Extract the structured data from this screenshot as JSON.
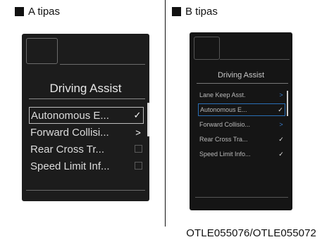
{
  "headers": {
    "a_label": "A tipas",
    "b_label": "B tipas"
  },
  "panel_a": {
    "title": "Driving Assist",
    "items": [
      {
        "label": "Autonomous E...",
        "control": "✓",
        "selected": true
      },
      {
        "label": "Forward Collisi...",
        "control": ">",
        "selected": false
      },
      {
        "label": "Rear Cross Tr...",
        "control": "checkbox-empty",
        "selected": false
      },
      {
        "label": "Speed Limit Inf...",
        "control": "checkbox-empty",
        "selected": false
      }
    ]
  },
  "panel_b": {
    "title": "Driving Assist",
    "items": [
      {
        "label": "Lane Keep Asst.",
        "control": ">",
        "selected": false
      },
      {
        "label": "Autonomous E...",
        "control": "✓",
        "selected": true
      },
      {
        "label": "Forward Collisio...",
        "control": ">",
        "selected": false
      },
      {
        "label": "Rear Cross Tra...",
        "control": "✓",
        "selected": false
      },
      {
        "label": "Speed Limit Info...",
        "control": "✓",
        "selected": false
      }
    ]
  },
  "image_code": "OTLE055076/OTLE055072",
  "colors": {
    "screen_bg": "#1c1c1c",
    "highlight_b": "#2a6fb6"
  }
}
